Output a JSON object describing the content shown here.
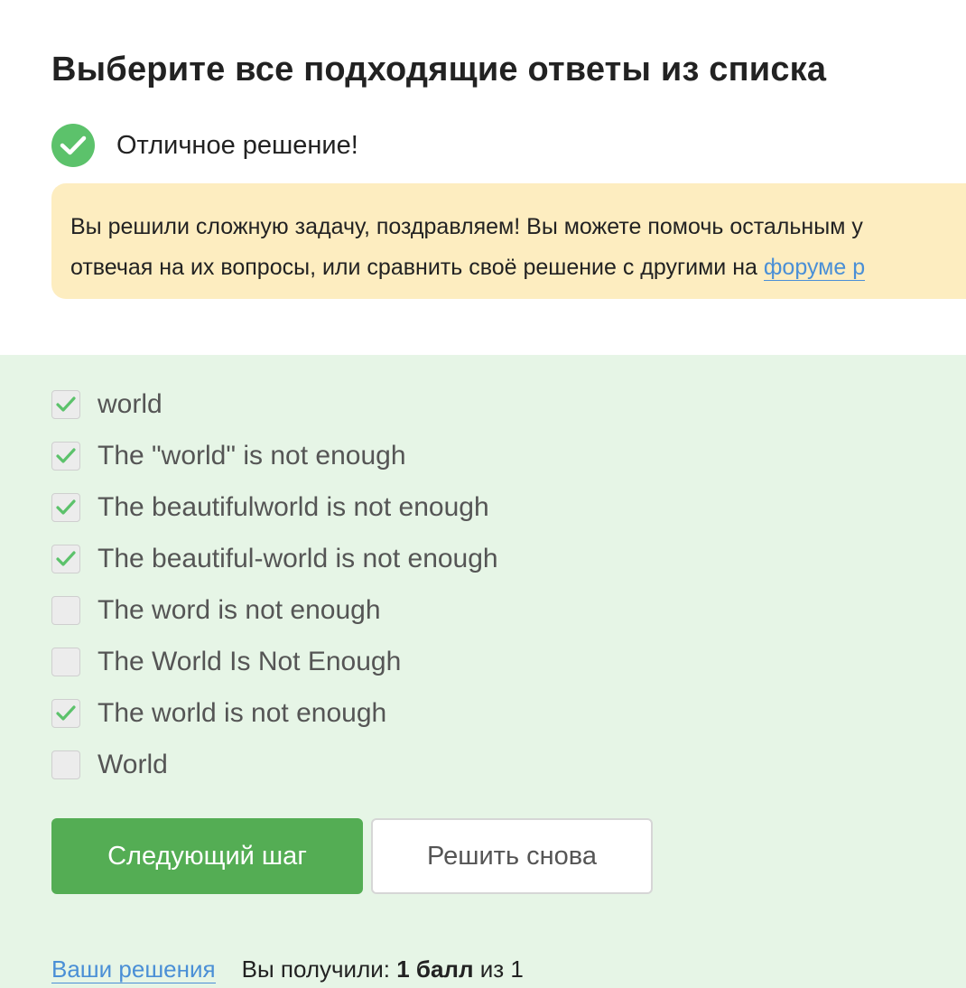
{
  "page": {
    "title": "Выберите все подходящие ответы из списка"
  },
  "status": {
    "icon": "check-circle-icon",
    "text": "Отличное решение!",
    "color": "#5cc26b"
  },
  "notice": {
    "text_before_link": "Вы решили сложную задачу, поздравляем! Вы можете помочь остальным учащимся, отвечая на их вопросы, или сравнить своё решение с другими на ",
    "line1": "Вы решили сложную задачу, поздравляем! Вы можете помочь остальным у",
    "line2_prefix": "отвечая на их вопросы, или сравнить своё решение с другими на ",
    "link_label": "форуме р",
    "background": "#fdedc0"
  },
  "options": [
    {
      "label": "world",
      "checked": true
    },
    {
      "label": "The \"world\" is not enough",
      "checked": true
    },
    {
      "label": "The beautifulworld is not enough",
      "checked": true
    },
    {
      "label": "The beautiful-world is not enough",
      "checked": true
    },
    {
      "label": "The word is not enough",
      "checked": false
    },
    {
      "label": "The World Is Not Enough",
      "checked": false
    },
    {
      "label": "The world is not enough",
      "checked": true
    },
    {
      "label": "World",
      "checked": false
    }
  ],
  "buttons": {
    "next_label": "Следующий шаг",
    "retry_label": "Решить снова",
    "primary_color": "#54ad54"
  },
  "footer": {
    "solutions_link": "Ваши решения",
    "score_prefix": "Вы получили: ",
    "score_value": "1 балл",
    "score_suffix": " из 1"
  },
  "colors": {
    "answer_area_background": "#e6f5e6",
    "link": "#4a8fd6"
  }
}
